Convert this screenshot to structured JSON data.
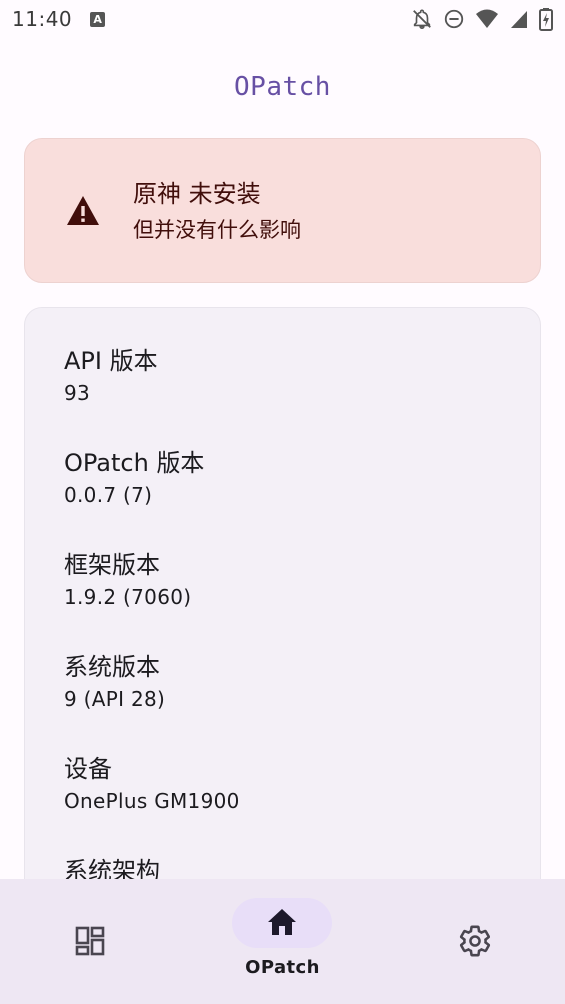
{
  "status_bar": {
    "time": "11:40",
    "notification_icon": "a-letter-icon",
    "icons": [
      "bell-off-icon",
      "do-not-disturb-icon",
      "wifi-icon",
      "cellular-signal-icon",
      "battery-icon"
    ]
  },
  "header": {
    "title": "OPatch"
  },
  "warning": {
    "icon": "warning-icon",
    "title": "原神 未安装",
    "subtitle": "但并没有什么影响"
  },
  "info": {
    "items": [
      {
        "label": "API 版本",
        "value": "93"
      },
      {
        "label": "OPatch 版本",
        "value": "0.0.7 (7)"
      },
      {
        "label": "框架版本",
        "value": "1.9.2 (7060)"
      },
      {
        "label": "系统版本",
        "value": "9 (API 28)"
      },
      {
        "label": "设备",
        "value": "OnePlus GM1900"
      },
      {
        "label": "系统架构",
        "value": ""
      }
    ]
  },
  "bottom_nav": {
    "items": [
      {
        "icon": "dashboard-icon",
        "label": ""
      },
      {
        "icon": "home-icon",
        "label": "OPatch",
        "selected": true
      },
      {
        "icon": "settings-gear-icon",
        "label": ""
      }
    ]
  },
  "colors": {
    "accent": "#6750A4",
    "warning_bg": "#F9DEDC",
    "card_bg": "#F4F0F7",
    "nav_bg": "#EEE7F3",
    "nav_indicator": "#E8DEF8"
  }
}
